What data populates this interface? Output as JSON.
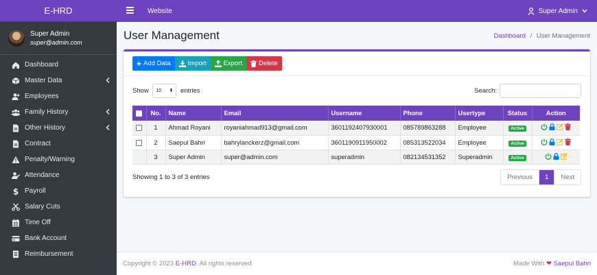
{
  "brand": "E-HRD",
  "user": {
    "name": "Super Admin",
    "email": "super@admin.com"
  },
  "nav": [
    {
      "label": "Dashboard",
      "icon": "home-icon",
      "caret": false
    },
    {
      "label": "Master Data",
      "icon": "cube-icon",
      "caret": true
    },
    {
      "label": "Employees",
      "icon": "user-plus-icon",
      "caret": false
    },
    {
      "label": "Family History",
      "icon": "users-icon",
      "caret": true
    },
    {
      "label": "Other History",
      "icon": "file-icon",
      "caret": true
    },
    {
      "label": "Contract",
      "icon": "file-icon",
      "caret": false
    },
    {
      "label": "Penalty/Warning",
      "icon": "warning-icon",
      "caret": false
    },
    {
      "label": "Attendance",
      "icon": "user-check-icon",
      "caret": false
    },
    {
      "label": "Payroll",
      "icon": "dollar-icon",
      "caret": false
    },
    {
      "label": "Salary Cuts",
      "icon": "scissors-icon",
      "caret": false
    },
    {
      "label": "Time Off",
      "icon": "calendar-icon",
      "caret": false
    },
    {
      "label": "Bank Account",
      "icon": "credit-card-icon",
      "caret": false
    },
    {
      "label": "Reimbursement",
      "icon": "receipt-icon",
      "caret": false
    }
  ],
  "topbar": {
    "link": "Website",
    "user": "Super Admin"
  },
  "page": {
    "title": "User Management"
  },
  "breadcrumb": {
    "home": "Dashboard",
    "sep": "/",
    "current": "User Management"
  },
  "toolbar": {
    "add": "Add Data",
    "import": "Import",
    "export": "Export",
    "delete": "Delete"
  },
  "controls": {
    "show": "Show",
    "entries_value": "10",
    "entries": "entries",
    "search": "Search:"
  },
  "table": {
    "headers": [
      "No.",
      "Name",
      "Email",
      "Username",
      "Phone",
      "Usertype",
      "Status",
      "Action"
    ],
    "rows": [
      {
        "no": "1",
        "name": "Ahmad Royani",
        "email": "royaniahmad913@gmail.com",
        "username": "3601192407930001",
        "phone": "085789863288",
        "usertype": "Employee",
        "status": "Active",
        "checkbox": true,
        "delete": true
      },
      {
        "no": "2",
        "name": "Saepul Bahri",
        "email": "bahrylanckerz@gmail.com",
        "username": "3601190911950002",
        "phone": "085313522034",
        "usertype": "Employee",
        "status": "Active",
        "checkbox": true,
        "delete": true
      },
      {
        "no": "3",
        "name": "Super Admin",
        "email": "super@admin.com",
        "username": "superadmin",
        "phone": "082134531352",
        "usertype": "Superadmin",
        "status": "Active",
        "checkbox": false,
        "delete": false
      }
    ]
  },
  "info": "Showing 1 to 3 of 3 entries",
  "pagination": {
    "prev": "Previous",
    "page": "1",
    "next": "Next"
  },
  "footer": {
    "copyright": "Copyright © 2023",
    "brand": "E-HRD",
    "rights": ". All rights reserved.",
    "made": "Made With",
    "author": "Saepul Bahri"
  },
  "colors": {
    "primary": "#6f42c1",
    "sidebar": "#343a40",
    "active": "#28a745",
    "danger": "#dc3545",
    "info": "#17a2b8",
    "blue": "#007bff",
    "warning": "#ffc107"
  }
}
